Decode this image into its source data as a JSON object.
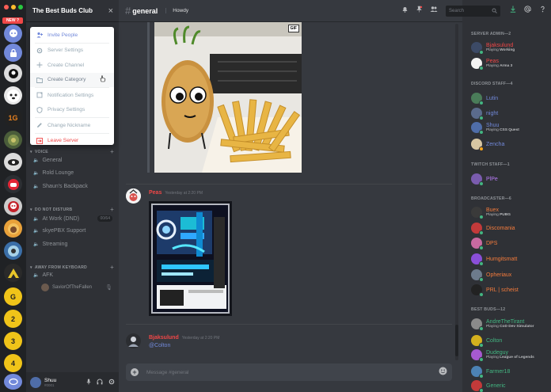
{
  "window": {
    "new_badge": "NEW ?"
  },
  "guild": {
    "name": "The Best Buds Club",
    "close": "×"
  },
  "dropdown": [
    {
      "label": "Invite People",
      "icon": "add-user-icon",
      "style": "primary"
    },
    {
      "label": "Server Settings",
      "icon": "gear-icon",
      "style": "normal"
    },
    {
      "label": "Create Channel",
      "icon": "plus-icon",
      "style": "normal"
    },
    {
      "label": "Create Category",
      "icon": "folder-plus-icon",
      "style": "hover"
    },
    {
      "label": "Notification Settings",
      "icon": "bell-icon",
      "style": "normal"
    },
    {
      "label": "Privacy Settings",
      "icon": "shield-icon",
      "style": "normal"
    },
    {
      "label": "Change Nickname",
      "icon": "pencil-icon",
      "style": "normal"
    },
    {
      "label": "Leave Server",
      "icon": "exit-icon",
      "style": "danger"
    }
  ],
  "servers": [
    "1G",
    "G",
    "2",
    "3",
    "4"
  ],
  "categories": {
    "voice": {
      "label": "VOICE",
      "channels": [
        "General",
        "Rold Lounge",
        "Shaun's Backpack"
      ]
    },
    "dnd": {
      "label": "DO NOT DISTURB",
      "channels": [
        "At Work (DND)",
        "skyePBX Support",
        "Streaming"
      ],
      "capacity": "00/64"
    },
    "afk": {
      "label": "AWAY FROM KEYBOARD",
      "channels": [
        "AFK"
      ],
      "voice_user": "SaviorOfTheFallen"
    }
  },
  "user": {
    "name": "Shuu",
    "tag": "#0001"
  },
  "chat": {
    "channel": "general",
    "topic": "Howdy",
    "search_placeholder": "Search",
    "composer_placeholder": "Message #general",
    "messages": [
      {
        "author": "Peas",
        "time": "Yesterday at 2:20 PM",
        "color": "#f04747"
      },
      {
        "author": "Bjaksulund",
        "time": "Yesterday at 2:20 PM",
        "text": "@Colton",
        "color": "#f04747"
      }
    ],
    "gif_label": "GIF"
  },
  "member_groups": [
    {
      "label": "SERVER ADMIN—2",
      "members": [
        {
          "name": "Bjaksulund",
          "color": "#f04747",
          "activity": "Playing",
          "game": "Working",
          "status": "#43b581"
        },
        {
          "name": "Peas",
          "color": "#f04747",
          "activity": "Playing",
          "game": "Arma 3",
          "status": "#43b581"
        }
      ]
    },
    {
      "label": "DISCORD STAFF—4",
      "members": [
        {
          "name": "Lutin",
          "color": "#7289da",
          "status": "#43b581"
        },
        {
          "name": "night",
          "color": "#7289da",
          "status": "#43b581"
        },
        {
          "name": "Shuu",
          "color": "#7289da",
          "activity": "Playing",
          "game": "CSS Quest",
          "status": "#43b581"
        },
        {
          "name": "Zencha",
          "color": "#7289da",
          "status": "#faa61a"
        }
      ]
    },
    {
      "label": "TWITCH STAFF—1",
      "members": [
        {
          "name": "PlPe",
          "color": "#b87cf6",
          "status": "#43b581"
        }
      ]
    },
    {
      "label": "BROADCASTER—6",
      "members": [
        {
          "name": "Buex",
          "color": "#f47b3c",
          "activity": "Playing",
          "game": "PUBG",
          "status": "#43b581"
        },
        {
          "name": "Discomania",
          "color": "#f47b3c",
          "status": "#43b581"
        },
        {
          "name": "DPS",
          "color": "#f47b3c",
          "status": "#43b581"
        },
        {
          "name": "Humgitsmatt",
          "color": "#f47b3c",
          "status": "#43b581"
        },
        {
          "name": "Opheriaux",
          "color": "#f47b3c",
          "status": "#43b581"
        },
        {
          "name": "PRL | scheist",
          "color": "#f47b3c",
          "status": "#43b581"
        }
      ]
    },
    {
      "label": "BEST BUDS—12",
      "members": [
        {
          "name": "AndreTheTirant",
          "color": "#43b581",
          "activity": "Playing",
          "game": "CoD Dev Simulator",
          "status": "#43b581"
        },
        {
          "name": "Colton",
          "color": "#43b581",
          "status": "#43b581"
        },
        {
          "name": "Dudeguy",
          "color": "#43b581",
          "activity": "Playing",
          "game": "League of Legends",
          "status": "#43b581"
        },
        {
          "name": "Farmer18",
          "color": "#43b581",
          "status": "#43b581"
        },
        {
          "name": "Generic",
          "color": "#43b581",
          "status": "#43b581"
        }
      ]
    }
  ],
  "colors": {
    "accent": "#7289da",
    "danger": "#f04747",
    "online": "#43b581"
  }
}
